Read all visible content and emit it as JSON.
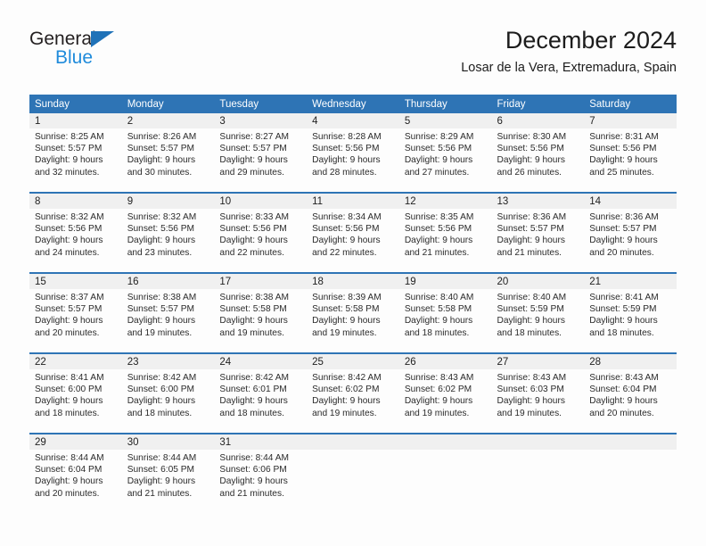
{
  "brand": {
    "name_top": "General",
    "name_bottom": "Blue",
    "triangle_color": "#1f72b8",
    "blue_text_color": "#1f8bdb"
  },
  "header": {
    "title": "December 2024",
    "subtitle": "Losar de la Vera, Extremadura, Spain"
  },
  "theme": {
    "header_bg": "#2e74b5",
    "header_text": "#ffffff",
    "daynum_bg": "#f0f0f0",
    "rule_color": "#2e74b5",
    "page_bg": "#fdfdfd"
  },
  "calendar": {
    "columns": [
      "Sunday",
      "Monday",
      "Tuesday",
      "Wednesday",
      "Thursday",
      "Friday",
      "Saturday"
    ],
    "weeks": [
      {
        "days": [
          {
            "num": "1",
            "sunrise": "Sunrise: 8:25 AM",
            "sunset": "Sunset: 5:57 PM",
            "daylight1": "Daylight: 9 hours",
            "daylight2": "and 32 minutes."
          },
          {
            "num": "2",
            "sunrise": "Sunrise: 8:26 AM",
            "sunset": "Sunset: 5:57 PM",
            "daylight1": "Daylight: 9 hours",
            "daylight2": "and 30 minutes."
          },
          {
            "num": "3",
            "sunrise": "Sunrise: 8:27 AM",
            "sunset": "Sunset: 5:57 PM",
            "daylight1": "Daylight: 9 hours",
            "daylight2": "and 29 minutes."
          },
          {
            "num": "4",
            "sunrise": "Sunrise: 8:28 AM",
            "sunset": "Sunset: 5:56 PM",
            "daylight1": "Daylight: 9 hours",
            "daylight2": "and 28 minutes."
          },
          {
            "num": "5",
            "sunrise": "Sunrise: 8:29 AM",
            "sunset": "Sunset: 5:56 PM",
            "daylight1": "Daylight: 9 hours",
            "daylight2": "and 27 minutes."
          },
          {
            "num": "6",
            "sunrise": "Sunrise: 8:30 AM",
            "sunset": "Sunset: 5:56 PM",
            "daylight1": "Daylight: 9 hours",
            "daylight2": "and 26 minutes."
          },
          {
            "num": "7",
            "sunrise": "Sunrise: 8:31 AM",
            "sunset": "Sunset: 5:56 PM",
            "daylight1": "Daylight: 9 hours",
            "daylight2": "and 25 minutes."
          }
        ]
      },
      {
        "days": [
          {
            "num": "8",
            "sunrise": "Sunrise: 8:32 AM",
            "sunset": "Sunset: 5:56 PM",
            "daylight1": "Daylight: 9 hours",
            "daylight2": "and 24 minutes."
          },
          {
            "num": "9",
            "sunrise": "Sunrise: 8:32 AM",
            "sunset": "Sunset: 5:56 PM",
            "daylight1": "Daylight: 9 hours",
            "daylight2": "and 23 minutes."
          },
          {
            "num": "10",
            "sunrise": "Sunrise: 8:33 AM",
            "sunset": "Sunset: 5:56 PM",
            "daylight1": "Daylight: 9 hours",
            "daylight2": "and 22 minutes."
          },
          {
            "num": "11",
            "sunrise": "Sunrise: 8:34 AM",
            "sunset": "Sunset: 5:56 PM",
            "daylight1": "Daylight: 9 hours",
            "daylight2": "and 22 minutes."
          },
          {
            "num": "12",
            "sunrise": "Sunrise: 8:35 AM",
            "sunset": "Sunset: 5:56 PM",
            "daylight1": "Daylight: 9 hours",
            "daylight2": "and 21 minutes."
          },
          {
            "num": "13",
            "sunrise": "Sunrise: 8:36 AM",
            "sunset": "Sunset: 5:57 PM",
            "daylight1": "Daylight: 9 hours",
            "daylight2": "and 21 minutes."
          },
          {
            "num": "14",
            "sunrise": "Sunrise: 8:36 AM",
            "sunset": "Sunset: 5:57 PM",
            "daylight1": "Daylight: 9 hours",
            "daylight2": "and 20 minutes."
          }
        ]
      },
      {
        "days": [
          {
            "num": "15",
            "sunrise": "Sunrise: 8:37 AM",
            "sunset": "Sunset: 5:57 PM",
            "daylight1": "Daylight: 9 hours",
            "daylight2": "and 20 minutes."
          },
          {
            "num": "16",
            "sunrise": "Sunrise: 8:38 AM",
            "sunset": "Sunset: 5:57 PM",
            "daylight1": "Daylight: 9 hours",
            "daylight2": "and 19 minutes."
          },
          {
            "num": "17",
            "sunrise": "Sunrise: 8:38 AM",
            "sunset": "Sunset: 5:58 PM",
            "daylight1": "Daylight: 9 hours",
            "daylight2": "and 19 minutes."
          },
          {
            "num": "18",
            "sunrise": "Sunrise: 8:39 AM",
            "sunset": "Sunset: 5:58 PM",
            "daylight1": "Daylight: 9 hours",
            "daylight2": "and 19 minutes."
          },
          {
            "num": "19",
            "sunrise": "Sunrise: 8:40 AM",
            "sunset": "Sunset: 5:58 PM",
            "daylight1": "Daylight: 9 hours",
            "daylight2": "and 18 minutes."
          },
          {
            "num": "20",
            "sunrise": "Sunrise: 8:40 AM",
            "sunset": "Sunset: 5:59 PM",
            "daylight1": "Daylight: 9 hours",
            "daylight2": "and 18 minutes."
          },
          {
            "num": "21",
            "sunrise": "Sunrise: 8:41 AM",
            "sunset": "Sunset: 5:59 PM",
            "daylight1": "Daylight: 9 hours",
            "daylight2": "and 18 minutes."
          }
        ]
      },
      {
        "days": [
          {
            "num": "22",
            "sunrise": "Sunrise: 8:41 AM",
            "sunset": "Sunset: 6:00 PM",
            "daylight1": "Daylight: 9 hours",
            "daylight2": "and 18 minutes."
          },
          {
            "num": "23",
            "sunrise": "Sunrise: 8:42 AM",
            "sunset": "Sunset: 6:00 PM",
            "daylight1": "Daylight: 9 hours",
            "daylight2": "and 18 minutes."
          },
          {
            "num": "24",
            "sunrise": "Sunrise: 8:42 AM",
            "sunset": "Sunset: 6:01 PM",
            "daylight1": "Daylight: 9 hours",
            "daylight2": "and 18 minutes."
          },
          {
            "num": "25",
            "sunrise": "Sunrise: 8:42 AM",
            "sunset": "Sunset: 6:02 PM",
            "daylight1": "Daylight: 9 hours",
            "daylight2": "and 19 minutes."
          },
          {
            "num": "26",
            "sunrise": "Sunrise: 8:43 AM",
            "sunset": "Sunset: 6:02 PM",
            "daylight1": "Daylight: 9 hours",
            "daylight2": "and 19 minutes."
          },
          {
            "num": "27",
            "sunrise": "Sunrise: 8:43 AM",
            "sunset": "Sunset: 6:03 PM",
            "daylight1": "Daylight: 9 hours",
            "daylight2": "and 19 minutes."
          },
          {
            "num": "28",
            "sunrise": "Sunrise: 8:43 AM",
            "sunset": "Sunset: 6:04 PM",
            "daylight1": "Daylight: 9 hours",
            "daylight2": "and 20 minutes."
          }
        ]
      },
      {
        "days": [
          {
            "num": "29",
            "sunrise": "Sunrise: 8:44 AM",
            "sunset": "Sunset: 6:04 PM",
            "daylight1": "Daylight: 9 hours",
            "daylight2": "and 20 minutes."
          },
          {
            "num": "30",
            "sunrise": "Sunrise: 8:44 AM",
            "sunset": "Sunset: 6:05 PM",
            "daylight1": "Daylight: 9 hours",
            "daylight2": "and 21 minutes."
          },
          {
            "num": "31",
            "sunrise": "Sunrise: 8:44 AM",
            "sunset": "Sunset: 6:06 PM",
            "daylight1": "Daylight: 9 hours",
            "daylight2": "and 21 minutes."
          },
          {
            "num": "",
            "sunrise": "",
            "sunset": "",
            "daylight1": "",
            "daylight2": ""
          },
          {
            "num": "",
            "sunrise": "",
            "sunset": "",
            "daylight1": "",
            "daylight2": ""
          },
          {
            "num": "",
            "sunrise": "",
            "sunset": "",
            "daylight1": "",
            "daylight2": ""
          },
          {
            "num": "",
            "sunrise": "",
            "sunset": "",
            "daylight1": "",
            "daylight2": ""
          }
        ]
      }
    ]
  }
}
